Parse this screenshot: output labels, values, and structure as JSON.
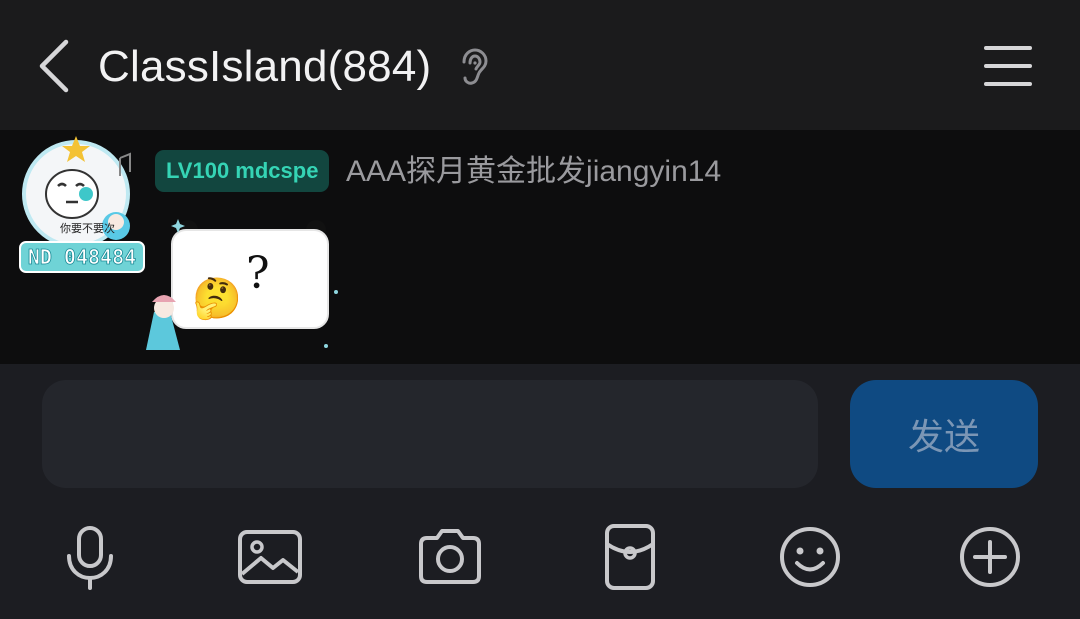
{
  "header": {
    "title": "ClassIsland(884)",
    "icons": {
      "back": "chevron-left-icon",
      "listen": "ear-icon",
      "menu": "hamburger-menu-icon"
    }
  },
  "message": {
    "avatar": {
      "name_plate": "ND 048484",
      "caption": "你要不要次"
    },
    "level_badge": "LV100 mdcspe",
    "sender": "AAA探月黄金批发jiangyin14",
    "sticker": {
      "emoji": "🤔",
      "text": "?"
    }
  },
  "input": {
    "value": "",
    "placeholder": "",
    "send_label": "发送"
  },
  "toolbar": {
    "items": [
      "microphone-icon",
      "image-icon",
      "camera-icon",
      "red-packet-icon",
      "emoji-icon",
      "plus-icon"
    ]
  },
  "colors": {
    "header_bg": "#1b1b1c",
    "chat_bg": "#0d0d0e",
    "input_bar_bg": "#1c1d22",
    "send_button": "#0f4a82",
    "level_badge_bg": "#12463f",
    "level_badge_text": "#35d4b5"
  }
}
